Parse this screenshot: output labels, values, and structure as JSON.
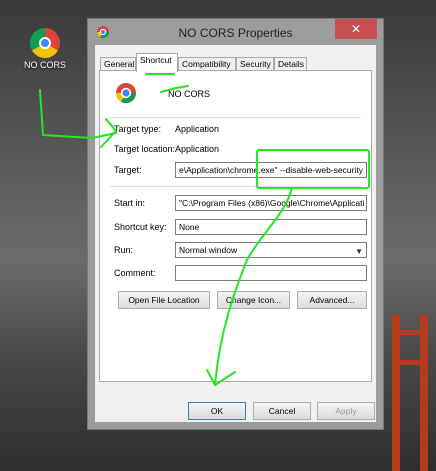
{
  "desktop": {
    "icon_label": "NO CORS"
  },
  "window": {
    "title": "NO CORS Properties",
    "close_glyph": "✕"
  },
  "tabs": [
    "General",
    "Shortcut",
    "Compatibility",
    "Security",
    "Details"
  ],
  "shortcut": {
    "name": "NO CORS",
    "target_type_label": "Target type:",
    "target_type_value": "Application",
    "target_location_label": "Target location:",
    "target_location_value": "Application",
    "target_label": "Target:",
    "target_value": "e\\Application\\chrome.exe\" --disable-web-security",
    "start_in_label": "Start in:",
    "start_in_value": "\"C:\\Program Files (x86)\\Google\\Chrome\\Applicati",
    "shortcut_key_label": "Shortcut key:",
    "shortcut_key_value": "None",
    "run_label": "Run:",
    "run_value": "Normal window",
    "comment_label": "Comment:",
    "comment_value": "",
    "open_file_location": "Open File Location",
    "change_icon": "Change Icon...",
    "advanced": "Advanced..."
  },
  "footer": {
    "ok": "OK",
    "cancel": "Cancel",
    "apply": "Apply"
  },
  "colors": {
    "annotation": "#22e822",
    "close": "#c75050",
    "bridge": "#b73a1f"
  },
  "icons": {
    "app": "chrome-icon",
    "close": "close-icon",
    "dropdown": "chevron-down-icon"
  }
}
